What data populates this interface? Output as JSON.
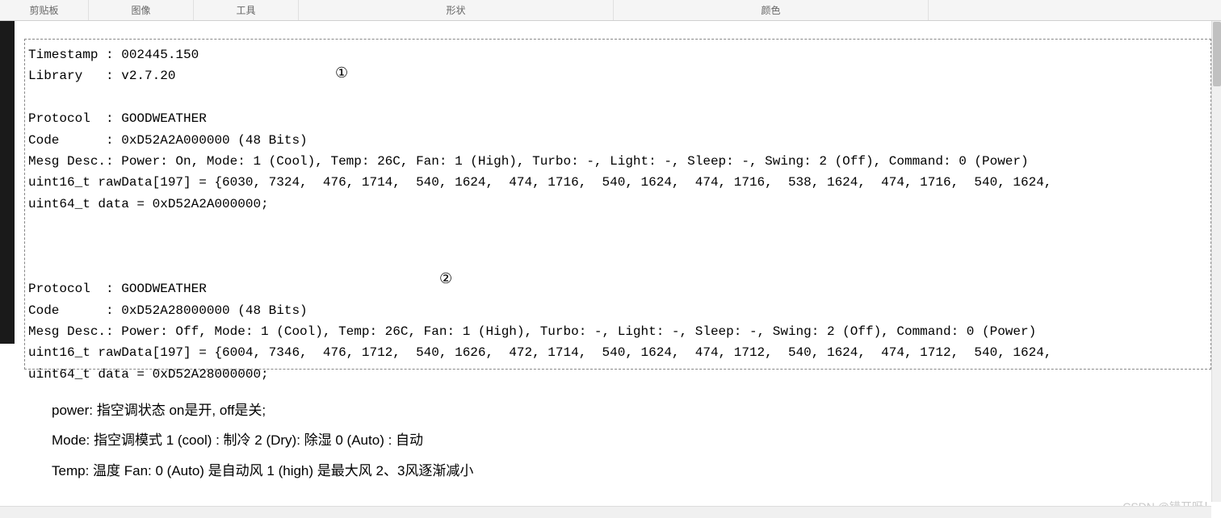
{
  "ribbon": {
    "clipboard": "剪贴板",
    "image": "图像",
    "tool": "工具",
    "shape": "形状",
    "color": "颜色"
  },
  "markers": {
    "one": "①",
    "two": "②"
  },
  "log": {
    "timestamp_label": "Timestamp : ",
    "timestamp_value": "002445.150",
    "library_label": "Library   : ",
    "library_value": "v2.7.20",
    "block1": {
      "protocol_label": "Protocol  : ",
      "protocol_value": "GOODWEATHER",
      "code_label": "Code      : ",
      "code_value": "0xD52A2A000000 (48 Bits)",
      "mesg_label": "Mesg Desc.: ",
      "mesg_value": "Power: On, Mode: 1 (Cool), Temp: 26C, Fan: 1 (High), Turbo: -, Light: -, Sleep: -, Swing: 2 (Off), Command: 0 (Power)",
      "raw_label": "uint16_t rawData[197] = ",
      "raw_value": "{6030, 7324,  476, 1714,  540, 1624,  474, 1716,  540, 1624,  474, 1716,  538, 1624,  474, 1716,  540, 1624,",
      "data_label": "uint64_t data = ",
      "data_value": "0xD52A2A000000;"
    },
    "block2": {
      "protocol_label": "Protocol  : ",
      "protocol_value": "GOODWEATHER",
      "code_label": "Code      : ",
      "code_value": "0xD52A28000000 (48 Bits)",
      "mesg_label": "Mesg Desc.: ",
      "mesg_value": "Power: Off, Mode: 1 (Cool), Temp: 26C, Fan: 1 (High), Turbo: -, Light: -, Sleep: -, Swing: 2 (Off), Command: 0 (Power)",
      "raw_label": "uint16_t rawData[197] = ",
      "raw_value": "{6004, 7346,  476, 1712,  540, 1626,  472, 1714,  540, 1624,  474, 1712,  540, 1624,  474, 1712,  540, 1624,",
      "data_label": "uint64_t data = ",
      "data_value": "0xD52A28000000;"
    }
  },
  "annotations": {
    "line1": "power:  指空调状态 on是开,   off是关;",
    "line2": "Mode:  指空调模式  1  (cool)  :  制冷    2 (Dry):  除湿   0  (Auto)  :   自动",
    "line3": "Temp:  温度         Fan:  0  (Auto)  是自动风   1  (high)  是最大风   2、3风逐渐减小"
  },
  "watermark": "CSDN @错开呀！"
}
